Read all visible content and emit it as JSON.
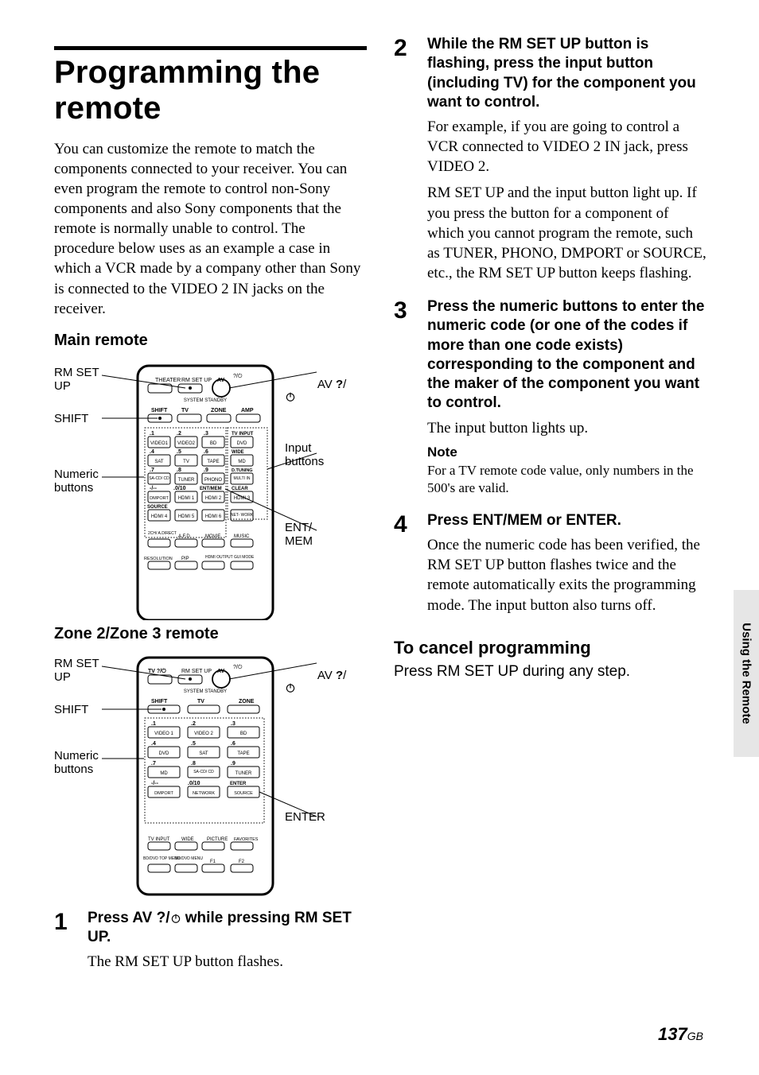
{
  "sideTab": "Using the Remote",
  "pageNumber": "137",
  "pageSuffix": "GB",
  "title": "Programming the remote",
  "intro": "You can customize the remote to match the components connected to your receiver. You can even program the remote to control non-Sony components and also Sony components that the remote is normally unable to control. The procedure below uses as an example a case in which a VCR made by a company other than Sony is connected to the VIDEO 2 IN jacks on the receiver.",
  "mainRemote": {
    "heading": "Main remote",
    "callouts": {
      "rmSetUp": "RM SET\nUP",
      "shift": "SHIFT",
      "numeric": "Numeric\nbuttons",
      "av": "AV ",
      "avSuffix": "/",
      "avBold": "?",
      "input": "Input\nbuttons",
      "entmem": "ENT/\nMEM"
    },
    "labels": {
      "theater": "THEATER",
      "rmSetUp": "RM SET UP",
      "av": "AV",
      "systemStandby": "SYSTEM STANDBY",
      "shift": "SHIFT",
      "tv": "TV",
      "zone": "ZONE",
      "amp": "AMP",
      "n1": ".1",
      "n2": ".2",
      "n3": ".3",
      "tvInput": "TV INPUT",
      "video1": "VIDEO1",
      "video2": "VIDEO2",
      "bd": "BD",
      "dvd": "DVD",
      "n4": ".4",
      "n5": ".5",
      "n6": ".6",
      "wide": "WIDE",
      "sat": "SAT",
      "tvBtn": "TV",
      "tape": "TAPE",
      "md": "MD",
      "n7": ".7",
      "n8": ".8",
      "n9": ".9",
      "dtuning": "D.TUNING",
      "sacd": "SA-CD/\nCD",
      "tuner": "TUNER",
      "phono": "PHONO",
      "multiin": "MULTI\nIN",
      "dash": "-/--",
      "n0": ".0/10",
      "entmem": "ENT/MEM",
      "clear": "CLEAR",
      "dmport": "DMPORT",
      "hdmi1": "HDMI 1",
      "hdmi2": "HDMI 2",
      "hdmi3": "HDMI 3",
      "source": "SOURCE",
      "hdmi4": "HDMI 4",
      "hdmi5": "HDMI 5",
      "hdmi6": "HDMI 6",
      "network": "NET-\nWORK",
      "twoCh": "2CH/\nA.DIRECT",
      "afd": "A.F.D.",
      "movie": "MOVIE",
      "music": "MUSIC",
      "resolution": "RESOLUTION",
      "pip": "PIP",
      "hdmiOut": "HDMI\nOUTPUT",
      "guiMode": "GUI\nMODE"
    }
  },
  "zoneRemote": {
    "heading": "Zone 2/Zone 3 remote",
    "callouts": {
      "rmSetUp": "RM SET\nUP",
      "shift": "SHIFT",
      "numeric": "Numeric\nbuttons",
      "av": "AV ",
      "avSuffix": "/",
      "enter": "ENTER"
    },
    "labels": {
      "tv": "TV",
      "rmSetUp": "RM SET UP",
      "av": "AV",
      "systemStandby": "SYSTEM STANDBY",
      "shift": "SHIFT",
      "tvMid": "TV",
      "zone": "ZONE",
      "n1": ".1",
      "n2": ".2",
      "n3": ".3",
      "video1": "VIDEO 1",
      "video2": "VIDEO 2",
      "bd": "BD",
      "n4": ".4",
      "n5": ".5",
      "n6": ".6",
      "dvd": "DVD",
      "sat": "SAT",
      "tape": "TAPE",
      "n7": ".7",
      "n8": ".8",
      "n9": ".9",
      "md": "MD",
      "sacd": "SA-CD/\nCD",
      "tuner": "TUNER",
      "dash": "-/--",
      "n0": ".0/10",
      "enter": "ENTER",
      "dmport": "DMPORT",
      "network": "NETWORK",
      "source": "SOURCE",
      "tvInput": "TV INPUT",
      "wide": "WIDE",
      "picture": "PICTURE",
      "favorites": "FAVORITES",
      "bdDvdTop": "BD/DVD\nTOP MENU",
      "bdDvdMenu": "BD/DVD\nMENU",
      "f1": "F1",
      "f2": "F2"
    }
  },
  "steps": {
    "s1": {
      "num": "1",
      "headPrefix": "Press AV ",
      "headBold": "?",
      "headMid": "/",
      "headSuffix": " while pressing RM SET UP.",
      "para": "The RM SET UP button flashes."
    },
    "s2": {
      "num": "2",
      "head": "While the RM SET UP button is flashing, press the input button (including TV) for the component you want to control.",
      "para1": "For example, if you are going to control a VCR connected to VIDEO 2 IN jack, press VIDEO 2.",
      "para2": "RM SET UP and the input button light up. If you press the button for a component of which you cannot program the remote, such as TUNER, PHONO, DMPORT or SOURCE, etc., the RM SET UP button keeps flashing."
    },
    "s3": {
      "num": "3",
      "head": "Press the numeric buttons to enter the numeric code (or one of the codes if more than one code exists) corresponding to the component and the maker of the component you want to control.",
      "para": "The input button lights up.",
      "noteHead": "Note",
      "noteBody": "For a TV remote code value, only numbers in the 500's are valid."
    },
    "s4": {
      "num": "4",
      "head": "Press ENT/MEM or ENTER.",
      "para": "Once the numeric code has been verified, the RM SET UP button flashes twice and the remote automatically exits the programming mode. The input button also turns off."
    }
  },
  "cancel": {
    "head": "To cancel programming",
    "body": "Press RM SET UP during any step."
  }
}
